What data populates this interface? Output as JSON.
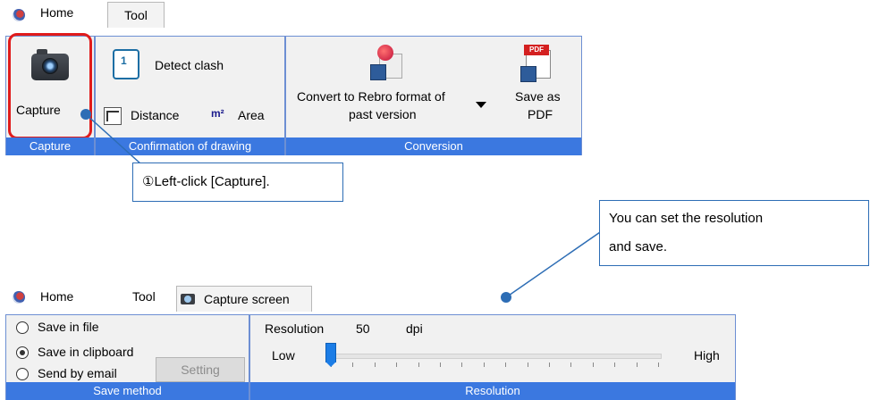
{
  "ribbon1": {
    "tabs": [
      "Home",
      "Tool"
    ],
    "groups": {
      "capture": {
        "button_label": "Capture",
        "group_label": "Capture"
      },
      "confirmation": {
        "detect_clash": "Detect clash",
        "distance": "Distance",
        "area": "Area",
        "group_label": "Confirmation of drawing"
      },
      "conversion": {
        "convert_line1": "Convert to Rebro format of",
        "convert_line2": "past version",
        "save_pdf_line1": "Save as",
        "save_pdf_line2": "PDF",
        "group_label": "Conversion"
      }
    },
    "pdf_tag": "PDF"
  },
  "callouts": {
    "capture_step": "①Left-click [Capture].",
    "resolution_line1": "You can set the resolution",
    "resolution_line2": "and save."
  },
  "ribbon2": {
    "tabs": [
      "Home",
      "Tool",
      "Capture screen"
    ],
    "save_method": {
      "options": [
        "Save in file",
        "Save in clipboard",
        "Send by email"
      ],
      "selected_index": 1,
      "setting_button": "Setting",
      "group_label": "Save method"
    },
    "resolution": {
      "label": "Resolution",
      "value": "50",
      "unit": "dpi",
      "low_label": "Low",
      "high_label": "High",
      "slider_fraction": 0.0,
      "group_label": "Resolution"
    }
  },
  "colors": {
    "group_label_bg": "#3b78e0",
    "highlight": "#e01b1b",
    "callout_border": "#2d6db5"
  }
}
